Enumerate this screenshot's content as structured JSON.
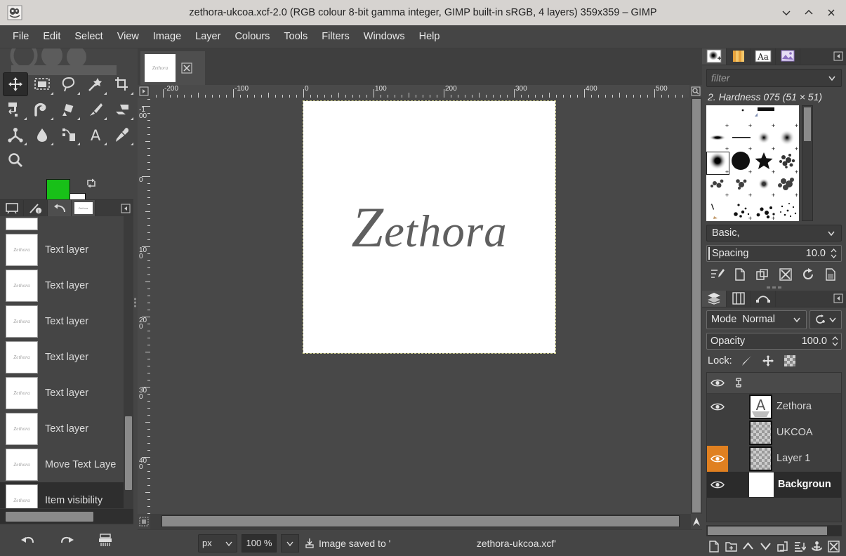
{
  "window": {
    "title": "zethora-ukcoa.xcf-2.0 (RGB colour 8-bit gamma integer, GIMP built-in sRGB, 4 layers) 359x359 – GIMP",
    "app_icon": "gimp-wilber-icon",
    "controls": [
      {
        "name": "minimize-button",
        "glyph": "⌄"
      },
      {
        "name": "maximize-button",
        "glyph": "⌃"
      },
      {
        "name": "close-button",
        "glyph": "✕"
      }
    ]
  },
  "menubar": {
    "items": [
      "File",
      "Edit",
      "Select",
      "View",
      "Image",
      "Layer",
      "Colours",
      "Tools",
      "Filters",
      "Windows",
      "Help"
    ]
  },
  "toolbox": {
    "tools": [
      {
        "name": "move-tool",
        "label": "Move",
        "active": true
      },
      {
        "name": "rectangle-select-tool",
        "label": "Rectangle Select",
        "active": false
      },
      {
        "name": "free-select-tool",
        "label": "Free Select",
        "active": false
      },
      {
        "name": "fuzzy-select-tool",
        "label": "Fuzzy Select",
        "active": false
      },
      {
        "name": "crop-tool",
        "label": "Crop",
        "active": false
      },
      {
        "name": "unified-transform-tool",
        "label": "Unified Transform",
        "active": false
      },
      {
        "name": "warp-transform-tool",
        "label": "Warp Transform",
        "active": false
      },
      {
        "name": "bucket-fill-tool",
        "label": "Bucket Fill",
        "active": false
      },
      {
        "name": "paintbrush-tool",
        "label": "Paintbrush",
        "active": false
      },
      {
        "name": "eraser-tool",
        "label": "Eraser",
        "active": false
      },
      {
        "name": "smudge-tool",
        "label": "Smudge",
        "active": false
      },
      {
        "name": "blur-sharpen-tool",
        "label": "Blur / Sharpen",
        "active": false
      },
      {
        "name": "paths-tool",
        "label": "Paths",
        "active": false
      },
      {
        "name": "text-tool",
        "label": "Text",
        "active": false
      },
      {
        "name": "color-picker-tool",
        "label": "Colour Picker",
        "active": false
      },
      {
        "name": "zoom-tool",
        "label": "Zoom",
        "active": false
      }
    ],
    "colors": {
      "foreground": "#18c018",
      "background": "#ffffff",
      "swap_icon": "swap-colors-icon",
      "reset_icon": "reset-colors-icon"
    }
  },
  "left_dock": {
    "tabs": [
      {
        "name": "tab-images",
        "icon": "images-icon",
        "active": false
      },
      {
        "name": "tab-pointer",
        "icon": "pointer-info-icon",
        "active": false
      },
      {
        "name": "tab-undo-history",
        "icon": "undo-history-icon",
        "active": true
      },
      {
        "name": "tab-document-thumb",
        "icon": "document-thumbnail-icon",
        "active": false,
        "thumb_text": "Zethora"
      }
    ],
    "menu_icon": "dock-menu-icon",
    "undo_history": {
      "items": [
        {
          "label": "",
          "thumb": "",
          "selected": false
        },
        {
          "label": "Text layer",
          "thumb": "Zethora",
          "selected": false
        },
        {
          "label": "Text layer",
          "thumb": "Zethora",
          "selected": false
        },
        {
          "label": "Text layer",
          "thumb": "Zethora",
          "selected": false
        },
        {
          "label": "Text layer",
          "thumb": "Zethora",
          "selected": false
        },
        {
          "label": "Text layer",
          "thumb": "Zethora",
          "selected": false
        },
        {
          "label": "Text layer",
          "thumb": "Zethora",
          "selected": false
        },
        {
          "label": "Move Text Laye",
          "thumb": "Zethora",
          "selected": false
        },
        {
          "label": "Item visibility",
          "thumb": "Zethora",
          "selected": true
        }
      ],
      "buttons": [
        {
          "name": "undo-button",
          "icon": "undo-arrow-icon"
        },
        {
          "name": "redo-button",
          "icon": "redo-arrow-icon"
        },
        {
          "name": "clear-undo-history-button",
          "icon": "shredder-icon"
        }
      ]
    }
  },
  "image_tabs": [
    {
      "name": "image-tab-zethora",
      "thumb_text": "Zethora",
      "close_icon": "close-x-icon"
    }
  ],
  "canvas": {
    "artwork_text_cap": "Z",
    "artwork_text_rest": "ethora",
    "h_ruler_labels": [
      "-200",
      "-100",
      "0",
      "100",
      "200",
      "300",
      "400",
      "500"
    ],
    "v_ruler_labels": [
      "-100",
      "0",
      "100",
      "200",
      "300",
      "400"
    ],
    "quick_mask_icon": "quick-mask-icon",
    "nav_icon": "navigation-preview-icon",
    "menu_arrow_icon": "menu-arrow-icon",
    "zoom_fit_icon": "zoom-fit-icon"
  },
  "statusbar": {
    "unit": "px",
    "zoom": "100 %",
    "save_icon": "save-disk-icon",
    "message": "Image saved to '",
    "filename": "zethora-ukcoa.xcf'"
  },
  "right_dock": {
    "top_tabs": [
      {
        "name": "tab-brushes",
        "icon": "brushes-icon",
        "active": true
      },
      {
        "name": "tab-patterns",
        "icon": "patterns-icon",
        "active": false
      },
      {
        "name": "tab-fonts",
        "icon": "fonts-icon",
        "active": false
      },
      {
        "name": "tab-gradients",
        "icon": "document-history-icon",
        "active": false
      }
    ],
    "menu_icon": "dock-menu-icon",
    "brushes": {
      "filter_placeholder": "filter",
      "selected_name": "2. Hardness 075 (51 × 51)",
      "tag_selector": "Basic,",
      "spacing_label": "Spacing",
      "spacing_value": "10.0",
      "buttons": [
        {
          "name": "edit-brush-button",
          "icon": "edit-brush-icon"
        },
        {
          "name": "new-brush-button",
          "icon": "new-document-icon"
        },
        {
          "name": "duplicate-brush-button",
          "icon": "duplicate-icon"
        },
        {
          "name": "delete-brush-button",
          "icon": "delete-x-icon"
        },
        {
          "name": "refresh-brushes-button",
          "icon": "refresh-icon"
        },
        {
          "name": "open-brush-as-image-button",
          "icon": "open-image-icon"
        }
      ]
    },
    "layers_tabs": [
      {
        "name": "tab-layers",
        "icon": "layers-icon",
        "active": true
      },
      {
        "name": "tab-channels",
        "icon": "channels-icon",
        "active": false
      },
      {
        "name": "tab-paths",
        "icon": "paths-icon",
        "active": false
      }
    ],
    "layers": {
      "mode_label": "Mode",
      "mode_value": "Normal",
      "mode_chevron": "chevron-down-icon",
      "switch_icon": "layer-mode-switch-icon",
      "opacity_label": "Opacity",
      "opacity_value": "100.0",
      "lock_label": "Lock:",
      "lock_buttons": [
        {
          "name": "lock-pixels-button",
          "icon": "brush-stroke-icon"
        },
        {
          "name": "lock-position-button",
          "icon": "move-cross-icon"
        },
        {
          "name": "lock-alpha-button",
          "icon": "checkerboard-icon"
        }
      ],
      "header": [
        {
          "name": "visibility-column-header",
          "icon": "eye-icon"
        },
        {
          "name": "link-column-header",
          "icon": "chain-link-icon"
        }
      ],
      "rows": [
        {
          "name": "Zethora",
          "visible": true,
          "highlighted": false,
          "thumb": "text-layer-thumb",
          "selected": false
        },
        {
          "name": "UKCOA",
          "visible": false,
          "highlighted": false,
          "thumb": "transparent-thumb",
          "selected": false
        },
        {
          "name": "Layer 1",
          "visible": true,
          "highlighted": true,
          "thumb": "transparent-thumb",
          "selected": false
        },
        {
          "name": "Backgroun",
          "visible": true,
          "highlighted": false,
          "thumb": "white-thumb",
          "selected": true
        }
      ],
      "buttons": [
        {
          "name": "new-layer-button",
          "icon": "new-document-icon"
        },
        {
          "name": "new-layer-group-button",
          "icon": "new-group-icon"
        },
        {
          "name": "raise-layer-button",
          "icon": "chevron-up-icon"
        },
        {
          "name": "lower-layer-button",
          "icon": "chevron-down-icon"
        },
        {
          "name": "duplicate-layer-button",
          "icon": "duplicate-icon"
        },
        {
          "name": "merge-down-button",
          "icon": "merge-down-icon"
        },
        {
          "name": "anchor-layer-button",
          "icon": "anchor-icon"
        },
        {
          "name": "delete-layer-button",
          "icon": "delete-x-icon"
        }
      ]
    }
  }
}
